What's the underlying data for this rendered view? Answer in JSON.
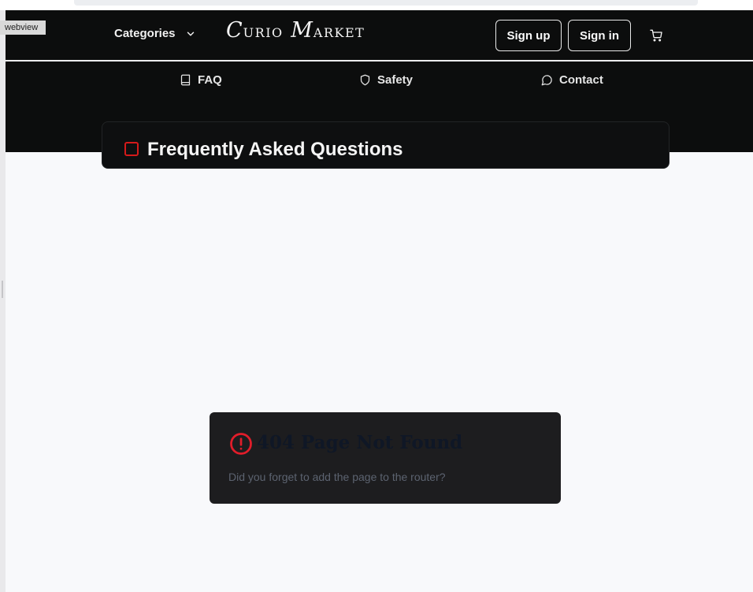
{
  "webview_label": "webview",
  "header": {
    "categories_label": "Categories",
    "logo": {
      "initial_c": "C",
      "rest_c": "URIO",
      "initial_m": "M",
      "rest_m": "ARKET"
    },
    "signup_label": "Sign up",
    "signin_label": "Sign in",
    "cart_icon": "cart-icon"
  },
  "subnav": {
    "items": [
      {
        "label": "FAQ",
        "icon": "book-icon"
      },
      {
        "label": "Safety",
        "icon": "shield-icon"
      },
      {
        "label": "Contact",
        "icon": "chat-bubble-icon"
      }
    ]
  },
  "faq": {
    "title": "Frequently Asked Questions"
  },
  "error_dialog": {
    "title": "404 Page Not Found",
    "message": "Did you forget to add the page to the router?",
    "icon": "alert-circle-icon",
    "accent": "#e11d2a"
  },
  "colors": {
    "header_bg": "#0c0d0d",
    "page_bg": "#f8f9fb",
    "dialog_bg": "#1d1d1f"
  }
}
